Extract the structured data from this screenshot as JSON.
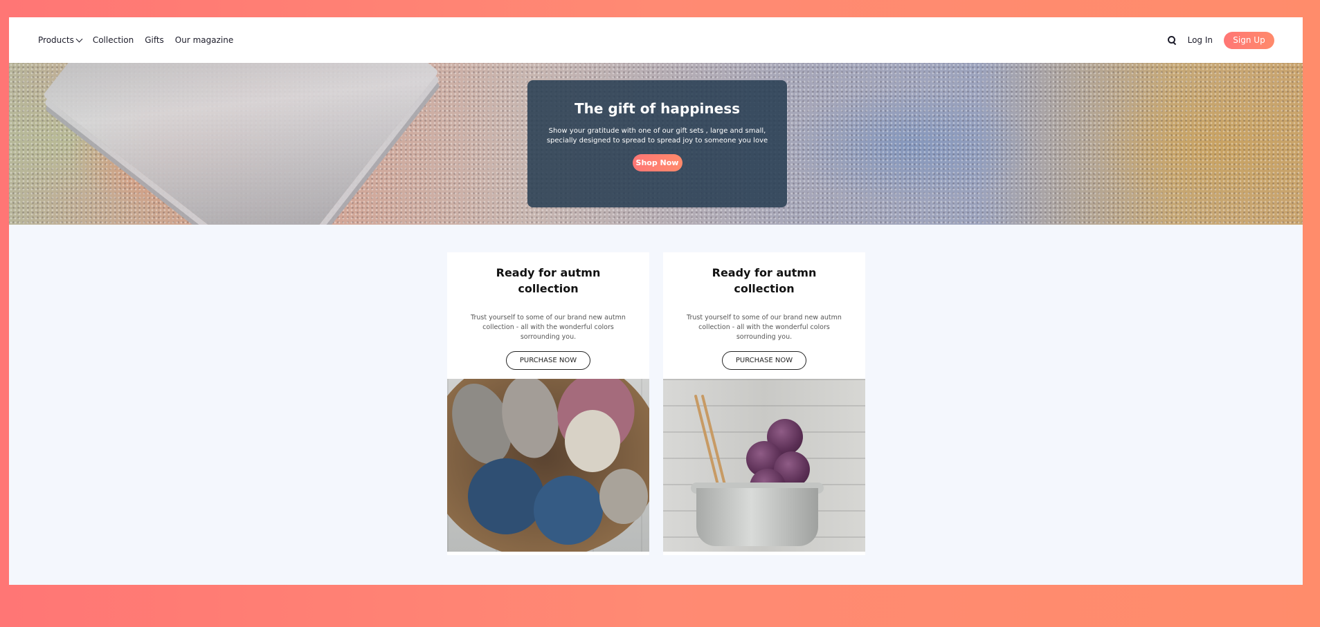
{
  "nav": {
    "products": "Products",
    "collection": "Collection",
    "gifts": "Gifts",
    "magazine": "Our magazine",
    "login": "Log In",
    "signup": "Sign Up"
  },
  "hero": {
    "title": "The gift of happiness",
    "text": "Show your gratitude with one of our gift sets , large and small, specially designed to spread to spread joy to someone you love",
    "button": "Shop Now"
  },
  "cards": [
    {
      "title": "Ready for autmn collection",
      "text": "Trust yourself to some of our brand new autmn collection - all with the wonderful colors sorrounding you.",
      "button": "PURCHASE NOW"
    },
    {
      "title": "Ready for autmn collection",
      "text": "Trust yourself to some of our brand new autmn collection - all with the wonderful colors sorrounding you.",
      "button": "PURCHASE NOW"
    }
  ],
  "colors": {
    "accent": "#ff7675",
    "hero_card": "#263c52",
    "page_bg": "#f4f7fd"
  },
  "icons": [
    "chevron-down-icon",
    "search-icon"
  ]
}
